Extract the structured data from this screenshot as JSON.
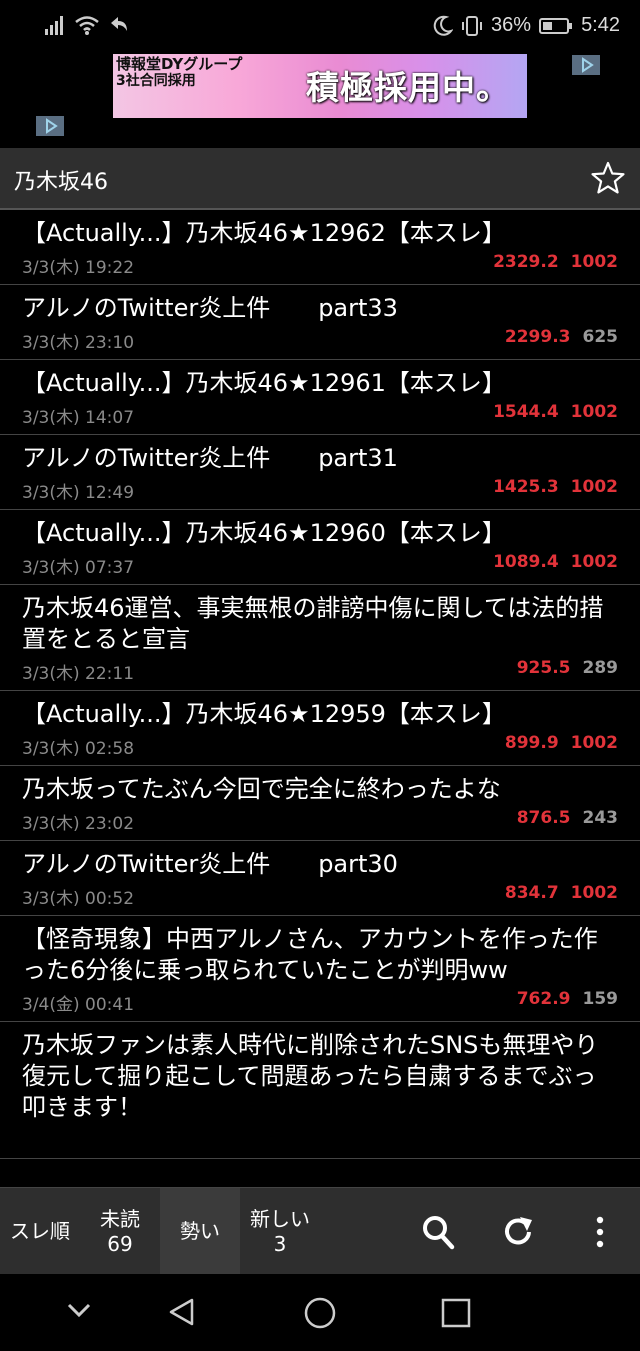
{
  "status_bar": {
    "battery_percent": "36%",
    "time": "5:42",
    "icons": [
      "signal-icon",
      "wifi-icon",
      "back-arrow-icon",
      "moon-icon",
      "vibrate-icon",
      "battery-icon"
    ]
  },
  "ad": {
    "line1": "博報堂DYグループ",
    "line2": "3社合同採用",
    "main": "積極採用中。"
  },
  "header": {
    "title": "乃木坂46"
  },
  "threads": [
    {
      "title": "【Actually...】乃木坂46★12962【本スレ】",
      "date": "3/3(木) 19:22",
      "ikioi": "2329.2",
      "count": "1002",
      "count_color": "red"
    },
    {
      "title": "アルノのTwitter炎上件　　part33",
      "date": "3/3(木) 23:10",
      "ikioi": "2299.3",
      "count": "625",
      "count_color": "gray"
    },
    {
      "title": "【Actually...】乃木坂46★12961【本スレ】",
      "date": "3/3(木) 14:07",
      "ikioi": "1544.4",
      "count": "1002",
      "count_color": "red"
    },
    {
      "title": "アルノのTwitter炎上件　　part31",
      "date": "3/3(木) 12:49",
      "ikioi": "1425.3",
      "count": "1002",
      "count_color": "red"
    },
    {
      "title": "【Actually...】乃木坂46★12960【本スレ】",
      "date": "3/3(木) 07:37",
      "ikioi": "1089.4",
      "count": "1002",
      "count_color": "red"
    },
    {
      "title": "乃木坂46運営、事実無根の誹謗中傷に関しては法的措置をとると宣言",
      "date": "3/3(木) 22:11",
      "ikioi": "925.5",
      "count": "289",
      "count_color": "gray"
    },
    {
      "title": "【Actually...】乃木坂46★12959【本スレ】",
      "date": "3/3(木) 02:58",
      "ikioi": "899.9",
      "count": "1002",
      "count_color": "red"
    },
    {
      "title": "乃木坂ってたぶん今回で完全に終わったよな",
      "date": "3/3(木) 23:02",
      "ikioi": "876.5",
      "count": "243",
      "count_color": "gray"
    },
    {
      "title": "アルノのTwitter炎上件　　part30",
      "date": "3/3(木) 00:52",
      "ikioi": "834.7",
      "count": "1002",
      "count_color": "red"
    },
    {
      "title": "【怪奇現象】中西アルノさん、アカウントを作った作った6分後に乗っ取られていたことが判明ww",
      "date": "3/4(金) 00:41",
      "ikioi": "762.9",
      "count": "159",
      "count_color": "gray"
    },
    {
      "title": "乃木坂ファンは素人時代に削除されたSNSも無理やり復元して掘り起こして問題あったら自粛するまでぶっ叩きます！",
      "date": "",
      "ikioi": "",
      "count": "",
      "count_color": "gray"
    }
  ],
  "toolbar": {
    "sort_thread": "スレ順",
    "unread_label": "未読",
    "unread_count": "69",
    "ikioi_label": "勢い",
    "new_label": "新しい",
    "new_count": "3",
    "icons": [
      "search-icon",
      "refresh-icon",
      "more-vert-icon"
    ]
  },
  "colors": {
    "accent_red": "#e2333a",
    "count_gray": "#9a9a9a",
    "header_bg": "#2f2f2f"
  }
}
